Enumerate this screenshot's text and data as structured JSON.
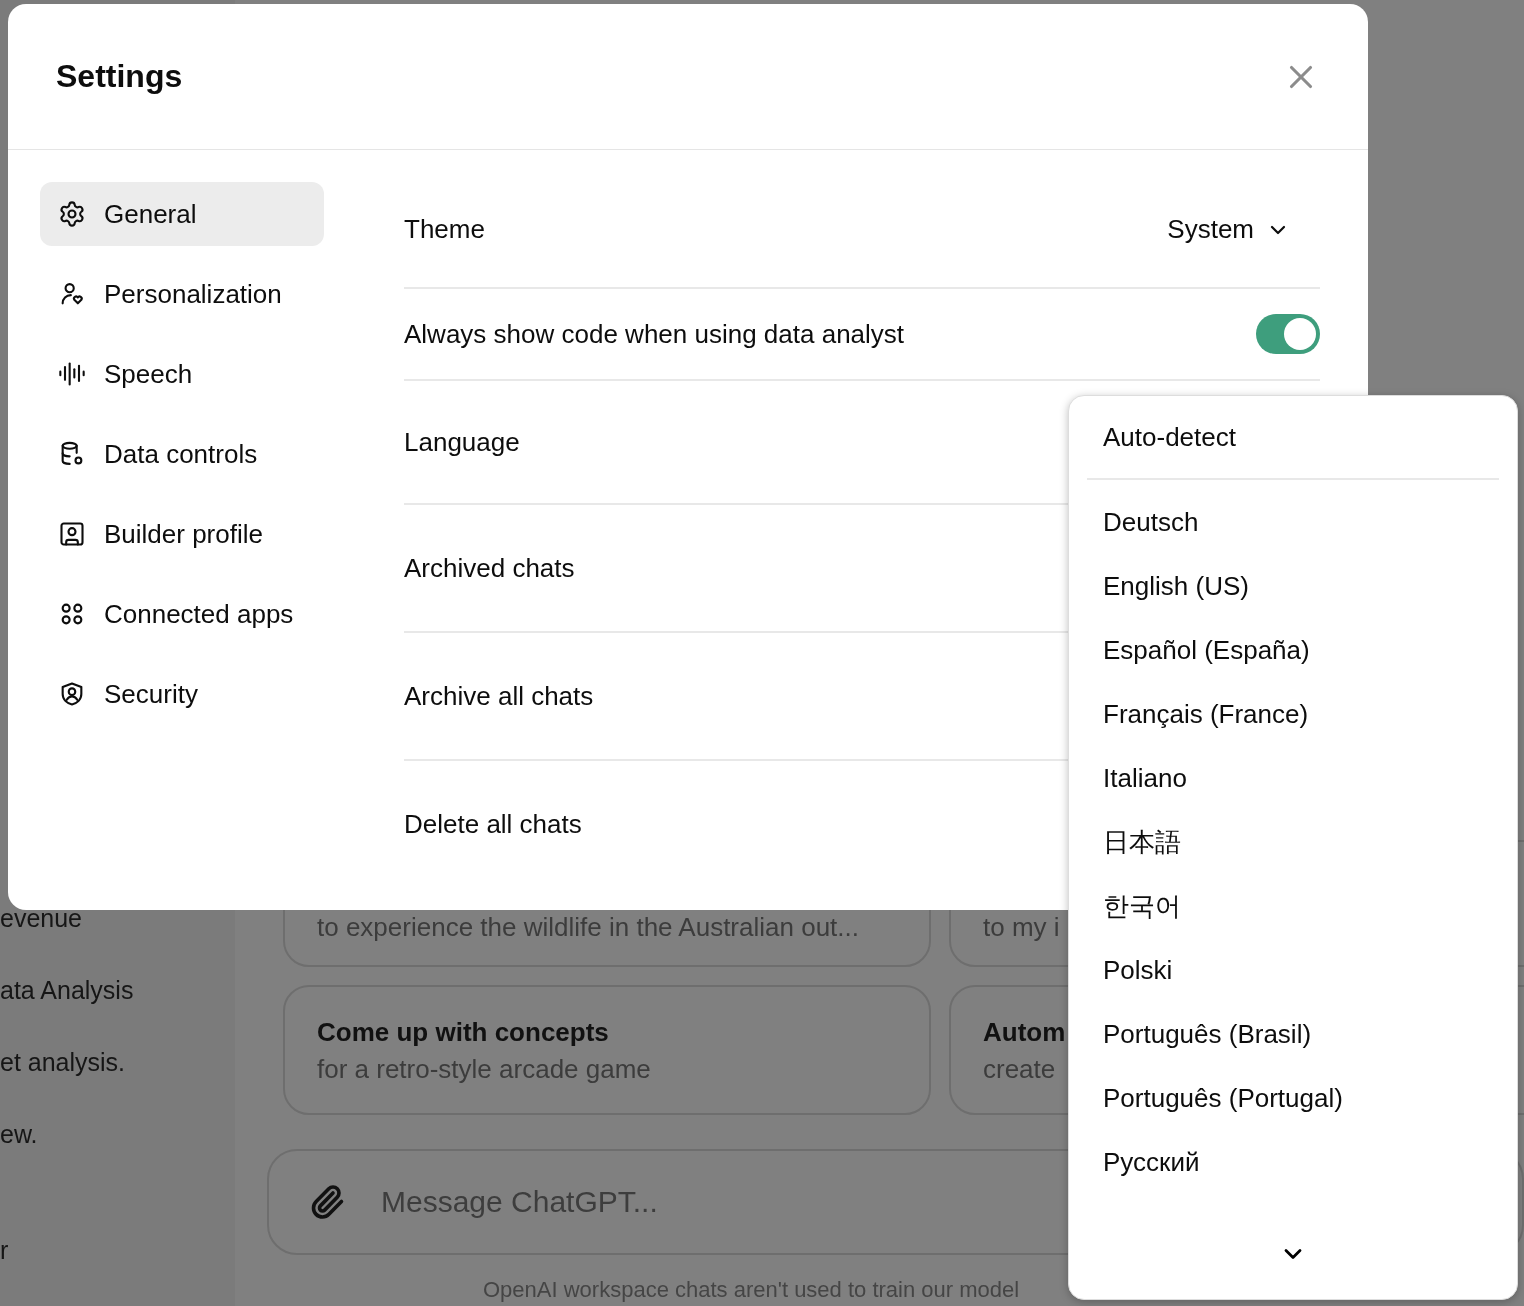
{
  "background": {
    "sidebar_items": [
      "evenue",
      "ata Analysis",
      "et analysis.",
      "ew.",
      "r"
    ],
    "suggestion_rows": [
      [
        {
          "subtitle": "to experience the wildlife in the Australian out..."
        },
        {
          "subtitle": "to my i"
        }
      ],
      [
        {
          "title": "Come up with concepts",
          "subtitle": "for a retro-style arcade game"
        },
        {
          "title": "Autom",
          "subtitle": "create"
        }
      ]
    ],
    "composer": {
      "placeholder": "Message ChatGPT..."
    },
    "footer": "OpenAI workspace chats aren't used to train our model"
  },
  "dialog": {
    "title": "Settings",
    "nav": [
      {
        "label": "General",
        "selected": true
      },
      {
        "label": "Personalization",
        "selected": false
      },
      {
        "label": "Speech",
        "selected": false
      },
      {
        "label": "Data controls",
        "selected": false
      },
      {
        "label": "Builder profile",
        "selected": false
      },
      {
        "label": "Connected apps",
        "selected": false
      },
      {
        "label": "Security",
        "selected": false
      }
    ],
    "settings": [
      {
        "kind": "select",
        "label": "Theme",
        "value": "System"
      },
      {
        "kind": "toggle",
        "label": "Always show code when using data analyst",
        "on": true
      },
      {
        "kind": "plain",
        "label": "Language"
      },
      {
        "kind": "plain",
        "label": "Archived chats"
      },
      {
        "kind": "plain",
        "label": "Archive all chats"
      },
      {
        "kind": "plain",
        "label": "Delete all chats"
      }
    ]
  },
  "language_menu": {
    "header_option": "Auto-detect",
    "options": [
      "Deutsch",
      "English (US)",
      "Español (España)",
      "Français (France)",
      "Italiano",
      "日本語",
      "한국어",
      "Polski",
      "Português (Brasil)",
      "Português (Portugal)",
      "Русский"
    ]
  }
}
